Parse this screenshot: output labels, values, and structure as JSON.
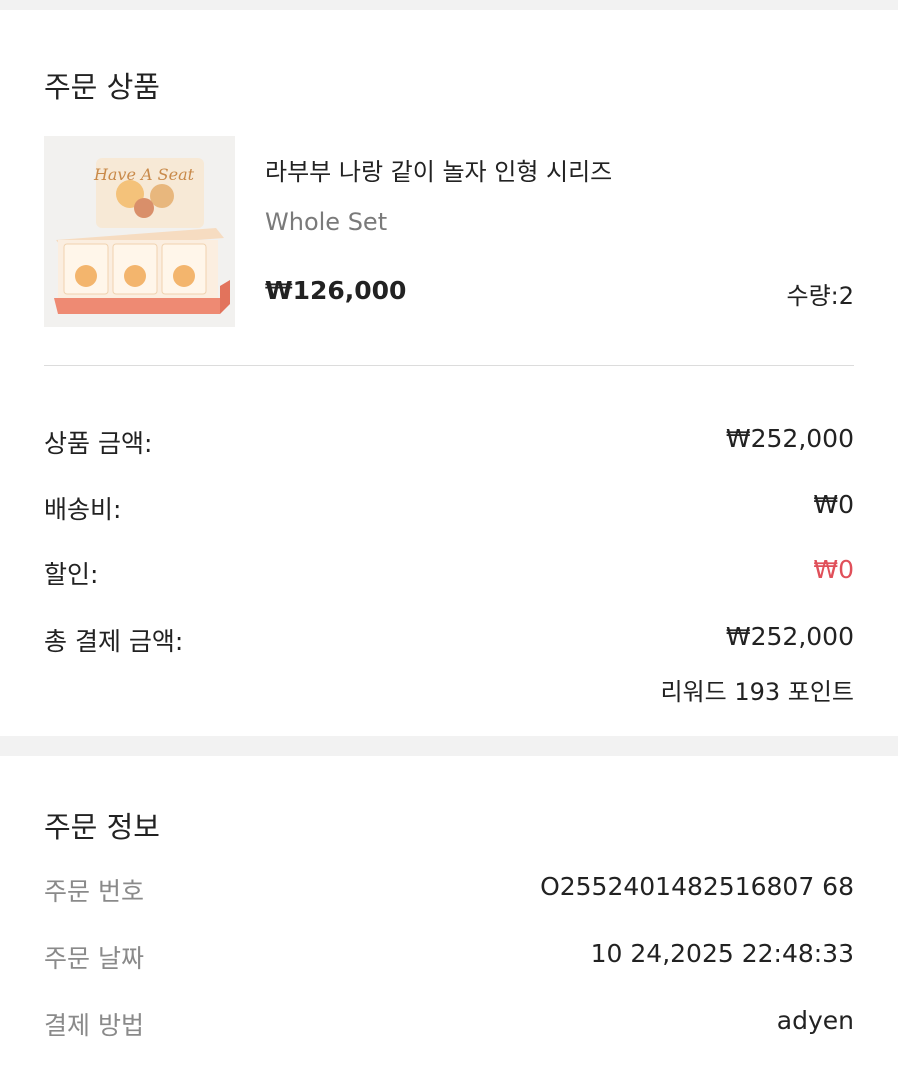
{
  "order_items": {
    "title": "주문 상품",
    "product": {
      "name": "라부부 나랑 같이 놀자 인형 시리즈",
      "variant": "Whole Set",
      "price": "₩126,000",
      "quantity": "수량:2",
      "image_text": "Have A Seat"
    },
    "summary": {
      "subtotal_label": "상품 금액:",
      "subtotal_value": "₩252,000",
      "shipping_label": "배송비:",
      "shipping_value": "₩0",
      "discount_label": "할인:",
      "discount_value": "₩0",
      "total_label": "총 결제 금액:",
      "total_value": "₩252,000",
      "reward": "리워드 193 포인트"
    }
  },
  "order_info": {
    "title": "주문 정보",
    "rows": [
      {
        "label": "주문 번호",
        "value": "O2552401482516807 68"
      },
      {
        "label": "주문 날짜",
        "value": "10 24,2025 22:48:33"
      },
      {
        "label": "결제 방법",
        "value": "adyen"
      }
    ]
  },
  "colors": {
    "discount": "#e0505a",
    "muted": "#8a8a8a",
    "background_gap": "#f2f2f2"
  }
}
